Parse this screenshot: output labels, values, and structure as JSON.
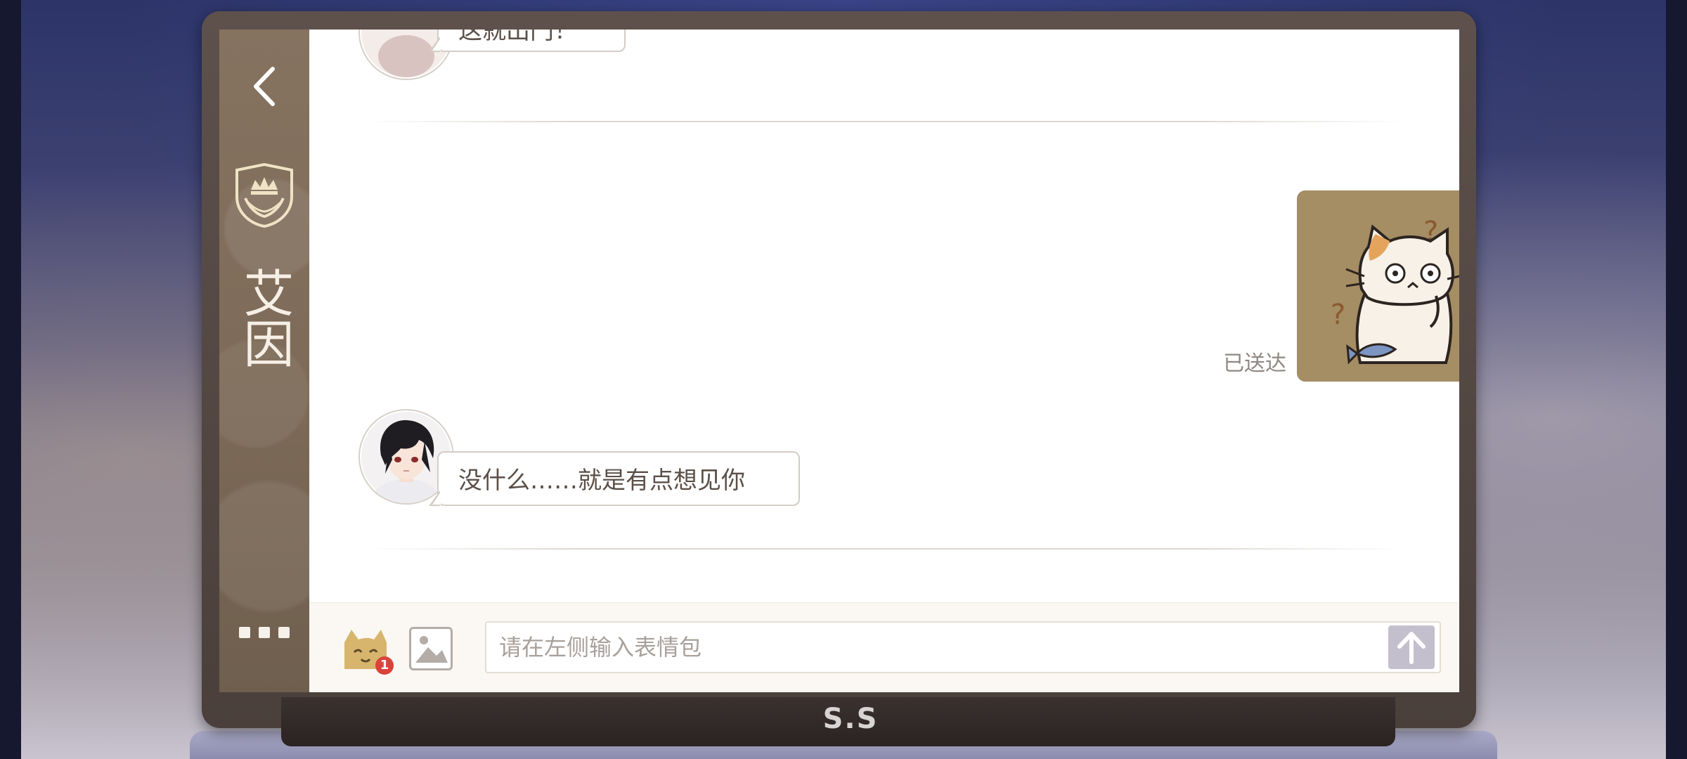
{
  "sidebar": {
    "contact_name_line1": "艾",
    "contact_name_line2": "因"
  },
  "messages": [
    {
      "side": "left",
      "text": "这就出门！",
      "cut_off": true
    },
    {
      "side": "right",
      "type": "sticker",
      "sticker": "confused-cat-sticker",
      "status": "已送达"
    },
    {
      "side": "left",
      "text": "没什么……就是有点想见你"
    }
  ],
  "input": {
    "placeholder": "请在左侧输入表情包",
    "emoji_badge_count": "1"
  },
  "device": {
    "brand_logo": "S.S"
  },
  "colors": {
    "sidebar": "#7d6a58",
    "sticker_bubble": "#a58d64",
    "badge": "#d9433a",
    "send_button": "#c4bfcd"
  }
}
